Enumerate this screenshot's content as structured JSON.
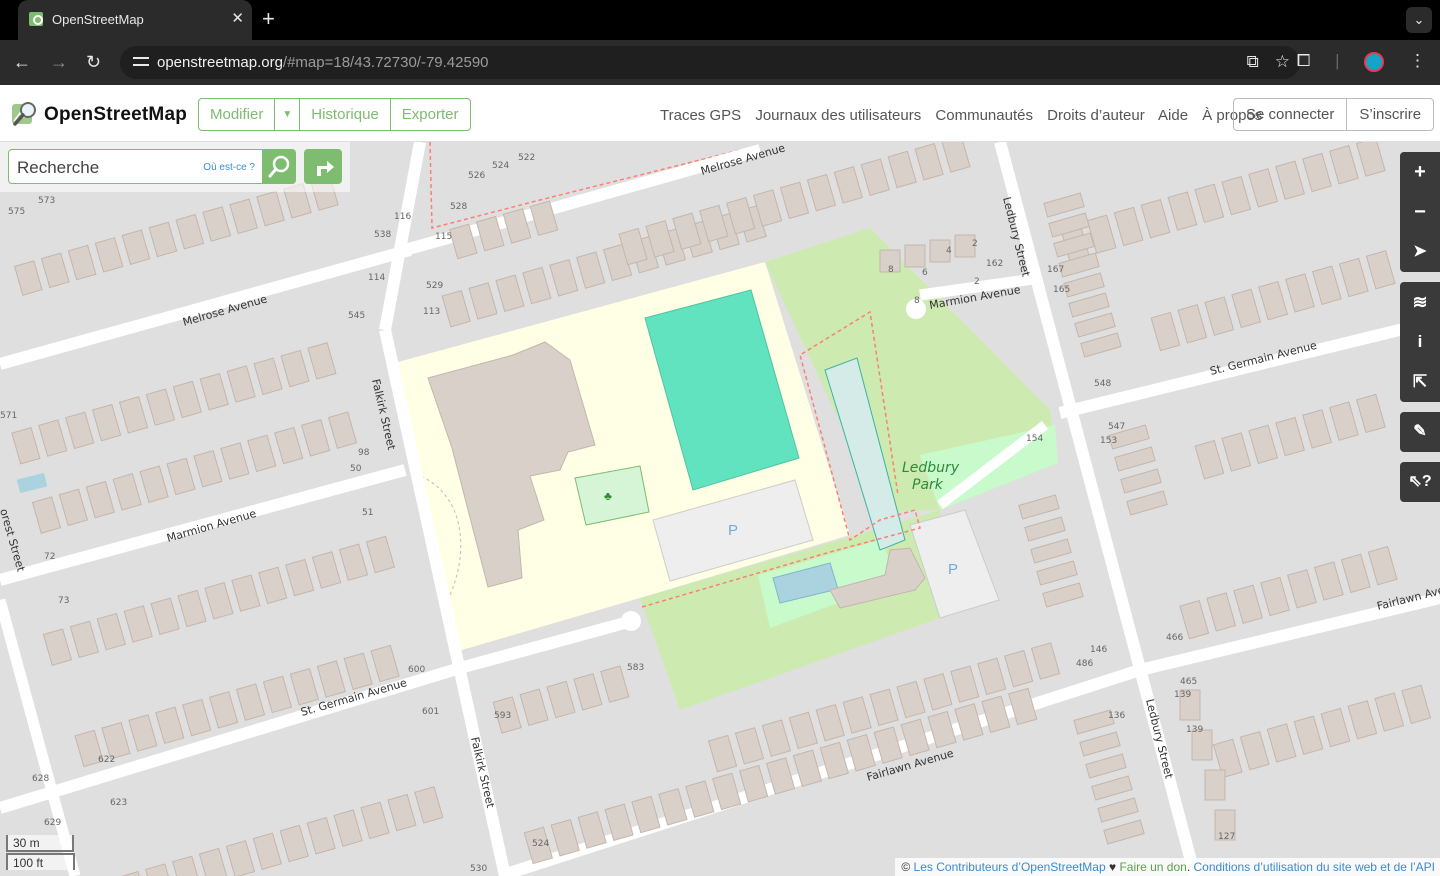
{
  "browser": {
    "tab_title": "OpenStreetMap",
    "url_host": "openstreetmap.org",
    "url_path": "/#map=18/43.72730/-79.42590"
  },
  "header": {
    "logo_text": "OpenStreetMap",
    "edit_label": "Modifier",
    "history_label": "Historique",
    "export_label": "Exporter",
    "links": [
      "Traces GPS",
      "Journaux des utilisateurs",
      "Communautés",
      "Droits d’auteur",
      "Aide",
      "À propos"
    ],
    "login_label": "Se connecter",
    "signup_label": "S’inscrire"
  },
  "search": {
    "placeholder": "Recherche",
    "where_label": "Où est-ce ?"
  },
  "map": {
    "streets": {
      "melrose_1": "Melrose Avenue",
      "melrose_2": "Melrose Avenue",
      "falkirk_1": "Falkirk Street",
      "falkirk_2": "Falkirk Street",
      "ledbury_1": "Ledbury Street",
      "ledbury_2": "Ledbury Street",
      "marmion_1": "Marmion Avenue",
      "marmion_2": "Marmion Avenue",
      "st_germain_1": "St. Germain Avenue",
      "st_germain_2": "St. Germain Avenue",
      "fairlawn_1": "Fairlawn Avenue",
      "fairlawn_2": "Fairlawn Ave",
      "forest": "orest Street"
    },
    "park_name_1": "Ledbury",
    "park_name_2": "Park",
    "parking_symbol": "P",
    "house_numbers": {
      "n575": "575",
      "n573": "573",
      "n571": "571",
      "n116": "116",
      "n538": "538",
      "n115": "115",
      "n528": "528",
      "n526": "526",
      "n524a": "524",
      "n522": "522",
      "n114": "114",
      "n529": "529",
      "n113": "113",
      "n545": "545",
      "n98": "98",
      "n50": "50",
      "n51": "51",
      "n72": "72",
      "n73": "73",
      "n571b": "571",
      "n600": "600",
      "n601": "601",
      "n583": "583",
      "n593": "593",
      "n622": "622",
      "n623": "623",
      "n628": "628",
      "n629": "629",
      "n530": "530",
      "n524b": "524",
      "n8a": "8",
      "n6": "6",
      "n4": "4",
      "n2a": "2",
      "n2b": "2",
      "n162": "162",
      "n8b": "8",
      "n167": "167",
      "n165": "165",
      "n548": "548",
      "n547": "547",
      "n153": "153",
      "n154": "154",
      "n146": "146",
      "n486": "486",
      "n466": "466",
      "n465": "465",
      "n139a": "139",
      "n139b": "139",
      "n136": "136",
      "n127": "127"
    }
  },
  "scale": {
    "metric": "30 m",
    "imperial": "100 ft"
  },
  "attribution": {
    "prefix": "© ",
    "contributors": "Les Contributeurs d’OpenStreetMap",
    "heart": " ♥ ",
    "donate": "Faire un don",
    "sep": ". ",
    "terms": "Conditions d’utilisation du site web et de l’API"
  },
  "colors": {
    "osm_green": "#7ebc6f",
    "land": "#f2efe9",
    "residential": "#e0dfdf",
    "building": "#d9d0c9",
    "school": "#ffffe5",
    "park": "#c8facc",
    "grass": "#cdebb0",
    "pitch": "#aae0cb",
    "sports_field": "#62e3c0",
    "water": "#aad3df",
    "parking": "#eeeeee",
    "footway": "#fa8072",
    "control_bg": "#3a3a3a"
  }
}
